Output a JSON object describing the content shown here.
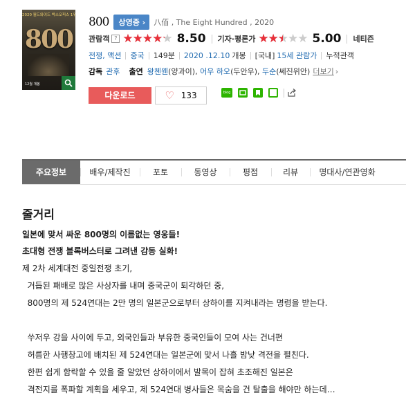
{
  "poster": {
    "banner": "2020 월드와이드 박스오피스 1위!",
    "big_text": "800",
    "tag": "12월 개봉"
  },
  "movie": {
    "title": "800",
    "status": "상영중",
    "original": "八佰 , The Eight Hundred , 2020"
  },
  "ratings": {
    "audience_label": "관람객",
    "audience_qmark": "?",
    "audience_score": "8.50",
    "audience_fraction": 0.85,
    "critic_label": "기자·평론가",
    "critic_score": "5.00",
    "critic_fraction": 0.5,
    "netizen_label": "네티즌"
  },
  "info": {
    "genres": "전쟁, 액션",
    "country": "중국",
    "runtime": "149분",
    "release_date": "2020 .12.10",
    "release_suffix": "개봉",
    "rating_prefix": "[국내]",
    "rating": "15세 관람가",
    "cumulative": "누적관객"
  },
  "credits": {
    "director_label": "감독",
    "director": "관후",
    "cast_label": "출연",
    "cast_1": "왕첸웬",
    "cast_1_role": "(양과이)",
    "cast_2": "어우 하오",
    "cast_2_role": "(두안우)",
    "cast_3": "두순",
    "cast_3_role": "(쎄진위안)",
    "more": "더보기"
  },
  "actions": {
    "download": "다운로드",
    "likes": "133",
    "blog_text": "blog"
  },
  "tabs": [
    {
      "label": "주요정보"
    },
    {
      "label": "배우/제작진"
    },
    {
      "label": "포토"
    },
    {
      "label": "동영상"
    },
    {
      "label": "평점"
    },
    {
      "label": "리뷰"
    },
    {
      "label": "명대사/연관영화"
    }
  ],
  "synopsis": {
    "heading": "줄거리",
    "lines": [
      "일본에 맞서 싸운 800명의 이름없는 영웅들!",
      "초대형 전쟁 블록버스터로 그려낸 감동 실화!",
      "제 2차 세계대전 중일전쟁 초기,",
      "  거듭된 패배로 많은 사상자를 내며 중국군이 퇴각하던 중,",
      "  800명의 제 524연대는 2만 명의 일본군으로부터 상하이를 지켜내라는 명령을 받는다.",
      "",
      "  쑤저우 강을 사이에 두고, 외국인들과 부유한 중국인들이 모여 사는 건너편",
      "  허름한 사행창고에 배치된 제 524연대는 일본군에 맞서 나흘 밤낮 격전을 펼친다.",
      "  한편 쉽게 함락할 수 있을 줄 알았던 상하이에서 발목이 잡혀 초조해진 일본은",
      "  격전지를 폭파할 계획을 세우고, 제 524연대 병사들은 목숨을 건 탈출을 해야만 하는데…"
    ]
  }
}
